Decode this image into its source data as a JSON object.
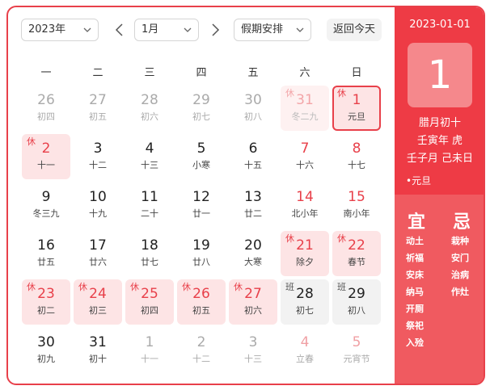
{
  "toolbar": {
    "year": "2023年",
    "month": "1月",
    "holiday": "假期安排",
    "today": "返回今天"
  },
  "weekdays": [
    "一",
    "二",
    "三",
    "四",
    "五",
    "六",
    "日"
  ],
  "days": [
    {
      "n": "26",
      "l": "初四",
      "t": "other"
    },
    {
      "n": "27",
      "l": "初五",
      "t": "other"
    },
    {
      "n": "28",
      "l": "初六",
      "t": "other"
    },
    {
      "n": "29",
      "l": "初七",
      "t": "other"
    },
    {
      "n": "30",
      "l": "初八",
      "t": "other"
    },
    {
      "n": "31",
      "l": "冬二九",
      "t": "holiday-other",
      "b": "休"
    },
    {
      "n": "1",
      "l": "元旦",
      "t": "holiday",
      "b": "休",
      "sel": true
    },
    {
      "n": "2",
      "l": "十一",
      "t": "holiday",
      "b": "休"
    },
    {
      "n": "3",
      "l": "十二",
      "t": "normal"
    },
    {
      "n": "4",
      "l": "十三",
      "t": "normal"
    },
    {
      "n": "5",
      "l": "小寒",
      "t": "normal"
    },
    {
      "n": "6",
      "l": "十五",
      "t": "normal"
    },
    {
      "n": "7",
      "l": "十六",
      "t": "weekend"
    },
    {
      "n": "8",
      "l": "十七",
      "t": "weekend"
    },
    {
      "n": "9",
      "l": "冬三九",
      "t": "normal"
    },
    {
      "n": "10",
      "l": "十九",
      "t": "normal"
    },
    {
      "n": "11",
      "l": "二十",
      "t": "normal"
    },
    {
      "n": "12",
      "l": "廿一",
      "t": "normal"
    },
    {
      "n": "13",
      "l": "廿二",
      "t": "normal"
    },
    {
      "n": "14",
      "l": "北小年",
      "t": "weekend"
    },
    {
      "n": "15",
      "l": "南小年",
      "t": "weekend"
    },
    {
      "n": "16",
      "l": "廿五",
      "t": "normal"
    },
    {
      "n": "17",
      "l": "廿六",
      "t": "normal"
    },
    {
      "n": "18",
      "l": "廿七",
      "t": "normal"
    },
    {
      "n": "19",
      "l": "廿八",
      "t": "normal"
    },
    {
      "n": "20",
      "l": "大寒",
      "t": "normal"
    },
    {
      "n": "21",
      "l": "除夕",
      "t": "holiday",
      "b": "休"
    },
    {
      "n": "22",
      "l": "春节",
      "t": "holiday",
      "b": "休"
    },
    {
      "n": "23",
      "l": "初二",
      "t": "holiday",
      "b": "休"
    },
    {
      "n": "24",
      "l": "初三",
      "t": "holiday",
      "b": "休"
    },
    {
      "n": "25",
      "l": "初四",
      "t": "holiday",
      "b": "休"
    },
    {
      "n": "26",
      "l": "初五",
      "t": "holiday",
      "b": "休"
    },
    {
      "n": "27",
      "l": "初六",
      "t": "holiday",
      "b": "休"
    },
    {
      "n": "28",
      "l": "初七",
      "t": "work",
      "b": "班"
    },
    {
      "n": "29",
      "l": "初八",
      "t": "work",
      "b": "班"
    },
    {
      "n": "30",
      "l": "初九",
      "t": "normal"
    },
    {
      "n": "31",
      "l": "初十",
      "t": "normal"
    },
    {
      "n": "1",
      "l": "十一",
      "t": "other"
    },
    {
      "n": "2",
      "l": "十二",
      "t": "other"
    },
    {
      "n": "3",
      "l": "十三",
      "t": "other"
    },
    {
      "n": "4",
      "l": "立春",
      "t": "other-weekend"
    },
    {
      "n": "5",
      "l": "元宵节",
      "t": "other-weekend"
    }
  ],
  "detail": {
    "date": "2023-01-01",
    "day": "1",
    "lunar": "腊月初十",
    "year_gz": "壬寅年 虎",
    "month_day_gz": "壬子月 己未日",
    "festival": "•元旦",
    "yi_title": "宜",
    "ji_title": "忌",
    "yi": [
      "动土",
      "祈福",
      "安床",
      "纳马",
      "开厕",
      "祭祀",
      "入殓"
    ],
    "ji": [
      "栽种",
      "安门",
      "治病",
      "作灶"
    ]
  },
  "colors": {
    "accent": "#e8404a",
    "holiday_bg": "#fde4e5",
    "work_bg": "#f2f2f2"
  }
}
